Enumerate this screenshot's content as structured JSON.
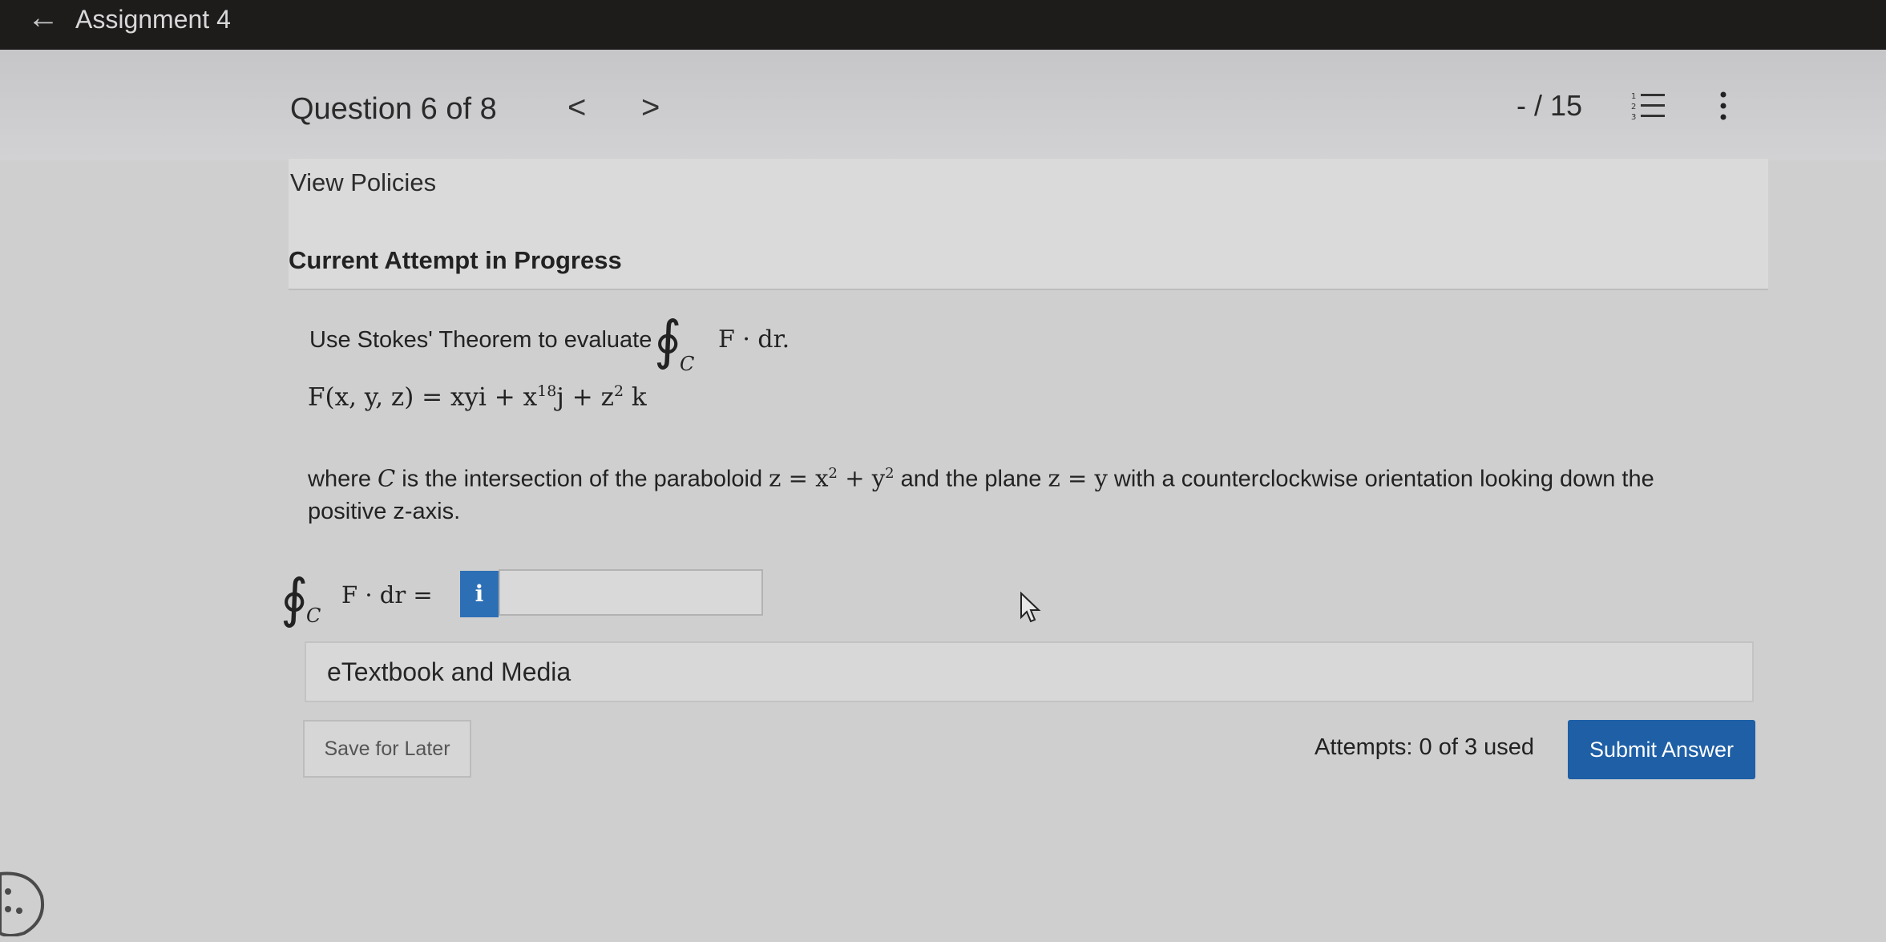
{
  "topbar": {
    "title": "Assignment 4"
  },
  "header": {
    "question_counter": "Question 6 of 8",
    "prev": "<",
    "next": ">",
    "score": "- / 15"
  },
  "policies": {
    "link": "View Policies",
    "attempt_status": "Current Attempt in Progress"
  },
  "question": {
    "prompt": "Use Stokes' Theorem to evaluate",
    "integral_subscript": "C",
    "integrand": "F · dr.",
    "field_lhs": "F(x, y, z) = xy",
    "field_rest_1": "i + x",
    "field_exp_1": "18",
    "field_rest_2": "j + z",
    "field_exp_2": "2",
    "field_rest_3": "k",
    "where_1": "where ",
    "where_c": "C",
    "where_2": " is the intersection of the paraboloid ",
    "paraboloid_1": "z = x",
    "paraboloid_exp": "2",
    "paraboloid_2": " + y",
    "paraboloid_exp2": "2",
    "where_3": " and the plane ",
    "plane": "z = y",
    "where_4": " with a counterclockwise orientation looking down the",
    "where_line2": "positive z-axis.",
    "answer_lhs": "F · dr =",
    "answer_subscript": "C",
    "info_label": "i",
    "answer_value": ""
  },
  "resources": {
    "etextbook": "eTextbook and Media"
  },
  "footer": {
    "save": "Save for Later",
    "attempts": "Attempts: 0 of 3 used",
    "submit": "Submit Answer"
  }
}
